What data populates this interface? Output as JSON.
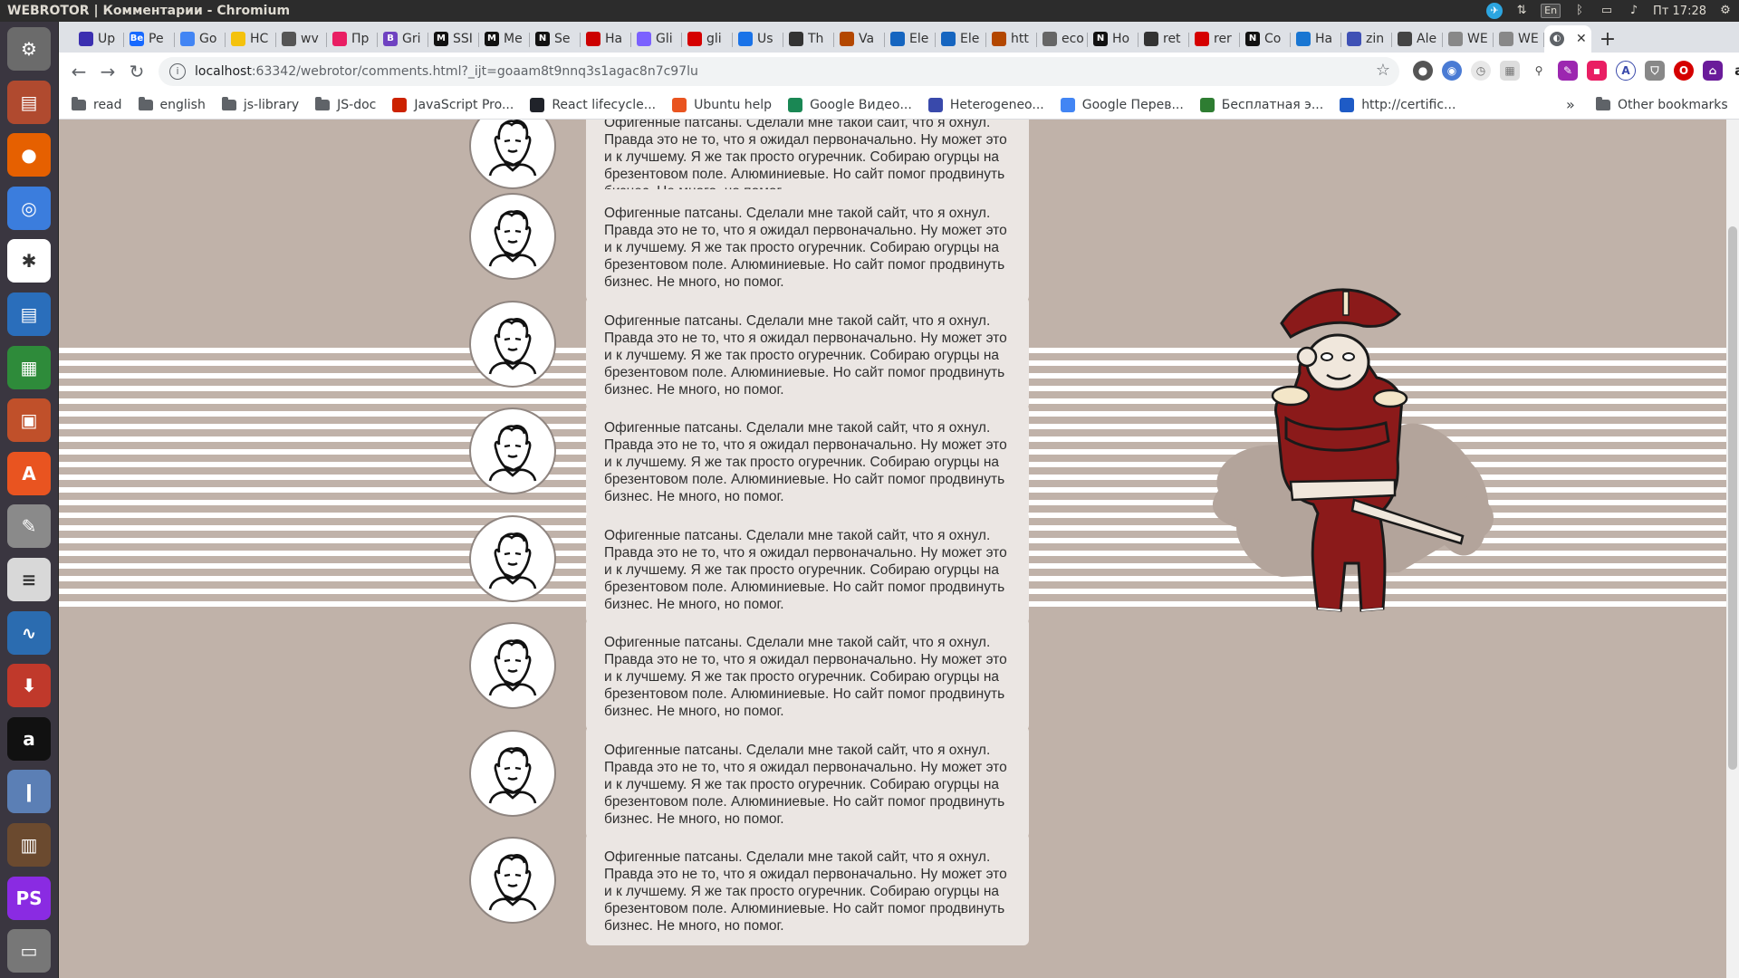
{
  "window": {
    "title": "WEBROTOR | Комментарии - Chromium"
  },
  "tray": {
    "lang": "En",
    "clock": "Пт 17:28"
  },
  "tabs": [
    {
      "label": "Up",
      "color": "#3b2fb0"
    },
    {
      "label": "Pe",
      "color": "#1769ff",
      "glyph": "Be"
    },
    {
      "label": "Go",
      "color": "#4285f4"
    },
    {
      "label": "HC",
      "color": "#f4c20d"
    },
    {
      "label": "wv",
      "color": "#555555"
    },
    {
      "label": "Пр",
      "color": "#e91e63"
    },
    {
      "label": "Gri",
      "color": "#6f42c1",
      "glyph": "B"
    },
    {
      "label": "SSI",
      "color": "#111111",
      "glyph": "M"
    },
    {
      "label": "Me",
      "color": "#111111",
      "glyph": "M"
    },
    {
      "label": "Se",
      "color": "#111111",
      "glyph": "N"
    },
    {
      "label": "Ha",
      "color": "#cc0000"
    },
    {
      "label": "Gli",
      "color": "#7b61ff"
    },
    {
      "label": "gli",
      "color": "#d50000"
    },
    {
      "label": "Us",
      "color": "#1a73e8"
    },
    {
      "label": "Th",
      "color": "#333333"
    },
    {
      "label": "Va",
      "color": "#b34700"
    },
    {
      "label": "Ele",
      "color": "#1565c0"
    },
    {
      "label": "Ele",
      "color": "#1565c0"
    },
    {
      "label": "htt",
      "color": "#b34700"
    },
    {
      "label": "eco",
      "color": "#666666"
    },
    {
      "label": "Ho",
      "color": "#111111",
      "glyph": "N"
    },
    {
      "label": "ret",
      "color": "#333333"
    },
    {
      "label": "rer",
      "color": "#d50000"
    },
    {
      "label": "Co",
      "color": "#111111",
      "glyph": "N"
    },
    {
      "label": "Ha",
      "color": "#1976d2"
    },
    {
      "label": "zin",
      "color": "#3f51b5"
    },
    {
      "label": "Ale",
      "color": "#444444"
    },
    {
      "label": "WE",
      "color": "#888888"
    },
    {
      "label": "WE",
      "color": "#888888"
    }
  ],
  "active_tab": {
    "close": "✕"
  },
  "new_tab": "+",
  "address": {
    "host": "localhost",
    "rest": ":63342/webrotor/comments.html?_ijt=goaam8t9nnq3s1agac8n7c97lu"
  },
  "bookmarks": [
    {
      "label": "read",
      "type": "folder"
    },
    {
      "label": "english",
      "type": "folder"
    },
    {
      "label": "js-library",
      "type": "folder"
    },
    {
      "label": "JS-doc",
      "type": "folder"
    },
    {
      "label": "JavaScript Pro...",
      "type": "site",
      "color": "#cc2200"
    },
    {
      "label": "React lifecycle...",
      "type": "site",
      "color": "#20232a"
    },
    {
      "label": "Ubuntu help",
      "type": "site",
      "color": "#e95420"
    },
    {
      "label": "Google Видео...",
      "type": "site",
      "color": "#1a8754"
    },
    {
      "label": "Heterogeneo...",
      "type": "site",
      "color": "#3949ab"
    },
    {
      "label": "Google Перев...",
      "type": "site",
      "color": "#4285f4"
    },
    {
      "label": "Бесплатная э...",
      "type": "site",
      "color": "#2e7d32"
    },
    {
      "label": "http://certific...",
      "type": "site",
      "color": "#1e5bc6"
    }
  ],
  "bookmarks_more": "»",
  "other_bookmarks": "Other bookmarks",
  "comments": [
    {
      "text": "Офигенные патсаны. Сделали мне такой сайт, что я охнул. Правда это не то, что я ожидал первоначально. Ну может это и к лучшему. Я же так просто огуречник. Собираю огурцы на брезентовом поле. Алюминиевые. Но сайт помог продвинуть бизнес. Не много, но помог."
    },
    {
      "text": "Офигенные патсаны. Сделали мне такой сайт, что я охнул. Правда это не то, что я ожидал первоначально. Ну может это и к лучшему. Я же так просто огуречник. Собираю огурцы на брезентовом поле. Алюминиевые. Но сайт помог продвинуть бизнес. Не много, но помог."
    },
    {
      "text": "Офигенные патсаны. Сделали мне такой сайт, что я охнул. Правда это не то, что я ожидал первоначально. Ну может это и к лучшему. Я же так просто огуречник. Собираю огурцы на брезентовом поле. Алюминиевые. Но сайт помог продвинуть бизнес. Не много, но помог."
    },
    {
      "text": "Офигенные патсаны. Сделали мне такой сайт, что я охнул. Правда это не то, что я ожидал первоначально. Ну может это и к лучшему. Я же так просто огуречник. Собираю огурцы на брезентовом поле. Алюминиевые. Но сайт помог продвинуть бизнес. Не много, но помог."
    },
    {
      "text": "Офигенные патсаны. Сделали мне такой сайт, что я охнул. Правда это не то, что я ожидал первоначально. Ну может это и к лучшему. Я же так просто огуречник. Собираю огурцы на брезентовом поле. Алюминиевые. Но сайт помог продвинуть бизнес. Не много, но помог."
    },
    {
      "text": "Офигенные патсаны. Сделали мне такой сайт, что я охнул. Правда это не то, что я ожидал первоначально. Ну может это и к лучшему. Я же так просто огуречник. Собираю огурцы на брезентовом поле. Алюминиевые. Но сайт помог продвинуть бизнес. Не много, но помог."
    },
    {
      "text": "Офигенные патсаны. Сделали мне такой сайт, что я охнул. Правда это не то, что я ожидал первоначально. Ну может это и к лучшему. Я же так просто огуречник. Собираю огурцы на брезентовом поле. Алюминиевые. Но сайт помог продвинуть бизнес. Не много, но помог."
    },
    {
      "text": "Офигенные патсаны. Сделали мне такой сайт, что я охнул. Правда это не то, что я ожидал первоначально. Ну может это и к лучшему. Я же так просто огуречник. Собираю огурцы на брезентовом поле. Алюминиевые. Но сайт помог продвинуть бизнес. Не много, но помог."
    }
  ],
  "launcher": [
    {
      "name": "ubuntu-settings-icon",
      "color": "#6b6b6b",
      "glyph": "⚙"
    },
    {
      "name": "files-icon",
      "color": "#b04a2f",
      "glyph": "▤"
    },
    {
      "name": "firefox-icon",
      "color": "#e66000",
      "glyph": "●"
    },
    {
      "name": "chromium-icon",
      "color": "#3b7ddd",
      "glyph": "◎"
    },
    {
      "name": "slack-icon",
      "color": "#ffffff",
      "glyph": "✱"
    },
    {
      "name": "writer-icon",
      "color": "#2a6ebb",
      "glyph": "▤"
    },
    {
      "name": "calc-icon",
      "color": "#2e8b3a",
      "glyph": "▦"
    },
    {
      "name": "impress-icon",
      "color": "#c0502a",
      "glyph": "▣"
    },
    {
      "name": "software-center-icon",
      "color": "#e95420",
      "glyph": "A"
    },
    {
      "name": "system-settings-icon",
      "color": "#8a8a8a",
      "glyph": "✎"
    },
    {
      "name": "text-editor-icon",
      "color": "#d8d8d8",
      "glyph": "≡"
    },
    {
      "name": "system-monitor-icon",
      "color": "#2b6cb0",
      "glyph": "∿"
    },
    {
      "name": "installer-icon",
      "color": "#c0392b",
      "glyph": "⬇"
    },
    {
      "name": "amazon-icon",
      "color": "#111111",
      "glyph": "a"
    },
    {
      "name": "thermometer-icon",
      "color": "#5b7fb5",
      "glyph": "ǀ"
    },
    {
      "name": "books-icon",
      "color": "#6b4a2f",
      "glyph": "▥"
    },
    {
      "name": "phpstorm-icon",
      "color": "#8a2be2",
      "glyph": "PS"
    },
    {
      "name": "scanner-icon",
      "color": "#777777",
      "glyph": "▭"
    }
  ]
}
